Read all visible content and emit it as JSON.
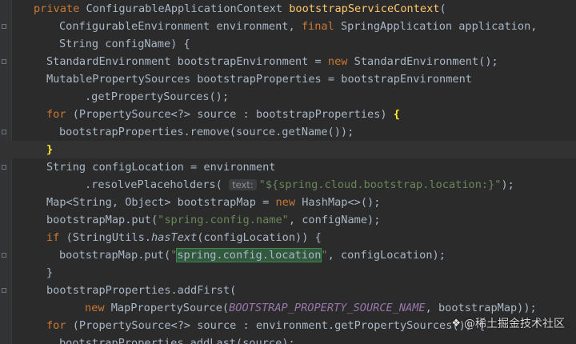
{
  "editor": {
    "lines": [
      {
        "indent": 1,
        "tokens": [
          {
            "t": "private ",
            "k": "kw"
          },
          {
            "t": "ConfigurableApplicationContext "
          },
          {
            "t": "bootstrapServiceContext",
            "k": "fn"
          },
          {
            "t": "("
          }
        ]
      },
      {
        "indent": 2,
        "tokens": [
          {
            "t": "ConfigurableEnvironment environment, "
          },
          {
            "t": "final ",
            "k": "kw"
          },
          {
            "t": "SpringApplication application,"
          }
        ]
      },
      {
        "indent": 2,
        "tokens": [
          {
            "t": "String configName) {"
          }
        ]
      },
      {
        "indent": 1.5,
        "tokens": [
          {
            "t": "StandardEnvironment bootstrapEnvironment = "
          },
          {
            "t": "new ",
            "k": "kw"
          },
          {
            "t": "StandardEnvironment();"
          }
        ]
      },
      {
        "indent": 1.5,
        "tokens": [
          {
            "t": "MutablePropertySources bootstrapProperties = bootstrapEnvironment"
          }
        ]
      },
      {
        "indent": 3,
        "tokens": [
          {
            "t": ".getPropertySources();"
          }
        ]
      },
      {
        "indent": 1.5,
        "tokens": [
          {
            "t": "for ",
            "k": "kw"
          },
          {
            "t": "(PropertySource<?> source : bootstrapProperties) "
          },
          {
            "t": "{",
            "k": "matchbrace"
          }
        ]
      },
      {
        "indent": 2,
        "tokens": [
          {
            "t": "bootstrapProperties.remove(source.getName());"
          }
        ]
      },
      {
        "indent": 1.5,
        "current": true,
        "tokens": [
          {
            "t": "}",
            "k": "matchbrace"
          }
        ]
      },
      {
        "indent": 1.5,
        "tokens": [
          {
            "t": "String configLocation = environment"
          }
        ]
      },
      {
        "indent": 3,
        "tokens": [
          {
            "t": ".resolvePlaceholders( "
          },
          {
            "t": "text:",
            "k": "hint"
          },
          {
            "t": "\"${spring.cloud.bootstrap.location:}\"",
            "k": "str"
          },
          {
            "t": ");"
          }
        ]
      },
      {
        "indent": 1.5,
        "tokens": [
          {
            "t": "Map<String, Object> bootstrapMap = "
          },
          {
            "t": "new ",
            "k": "kw"
          },
          {
            "t": "HashMap<>();"
          }
        ]
      },
      {
        "indent": 1.5,
        "tokens": [
          {
            "t": "bootstrapMap.put("
          },
          {
            "t": "\"spring.config.name\"",
            "k": "str"
          },
          {
            "t": ", configName);"
          }
        ]
      },
      {
        "indent": 1.5,
        "tokens": [
          {
            "t": "if ",
            "k": "kw"
          },
          {
            "t": "(StringUtils."
          },
          {
            "t": "hasText",
            "k": "italic"
          },
          {
            "t": "(configLocation)) {"
          }
        ]
      },
      {
        "indent": 2,
        "tokens": [
          {
            "t": "bootstrapMap.put("
          },
          {
            "t": "\"",
            "k": "str"
          },
          {
            "t": "spring.config.location",
            "k": "searchhit"
          },
          {
            "t": "\"",
            "k": "str"
          },
          {
            "t": ", configLocation);"
          }
        ]
      },
      {
        "indent": 1.5,
        "tokens": [
          {
            "t": "}"
          }
        ]
      },
      {
        "indent": 1.5,
        "tokens": [
          {
            "t": "bootstrapProperties.addFirst("
          }
        ]
      },
      {
        "indent": 3,
        "tokens": [
          {
            "t": "new ",
            "k": "kw"
          },
          {
            "t": "MapPropertySource("
          },
          {
            "t": "BOOTSTRAP_PROPERTY_SOURCE_NAME",
            "k": "const"
          },
          {
            "t": ", bootstrapMap));"
          }
        ]
      },
      {
        "indent": 1.5,
        "tokens": [
          {
            "t": "for ",
            "k": "kw"
          },
          {
            "t": "(PropertySource<?> source : environment.getPropertySources()) {"
          }
        ]
      },
      {
        "indent": 2,
        "tokens": [
          {
            "t": "bootstrapProperties.addLast(source);"
          }
        ]
      }
    ],
    "fold_markers": [
      1,
      3,
      7,
      9,
      14,
      16
    ]
  },
  "watermark": {
    "logo_icon": "juejin-logo-icon",
    "text": "@稀土掘金技术社区"
  }
}
